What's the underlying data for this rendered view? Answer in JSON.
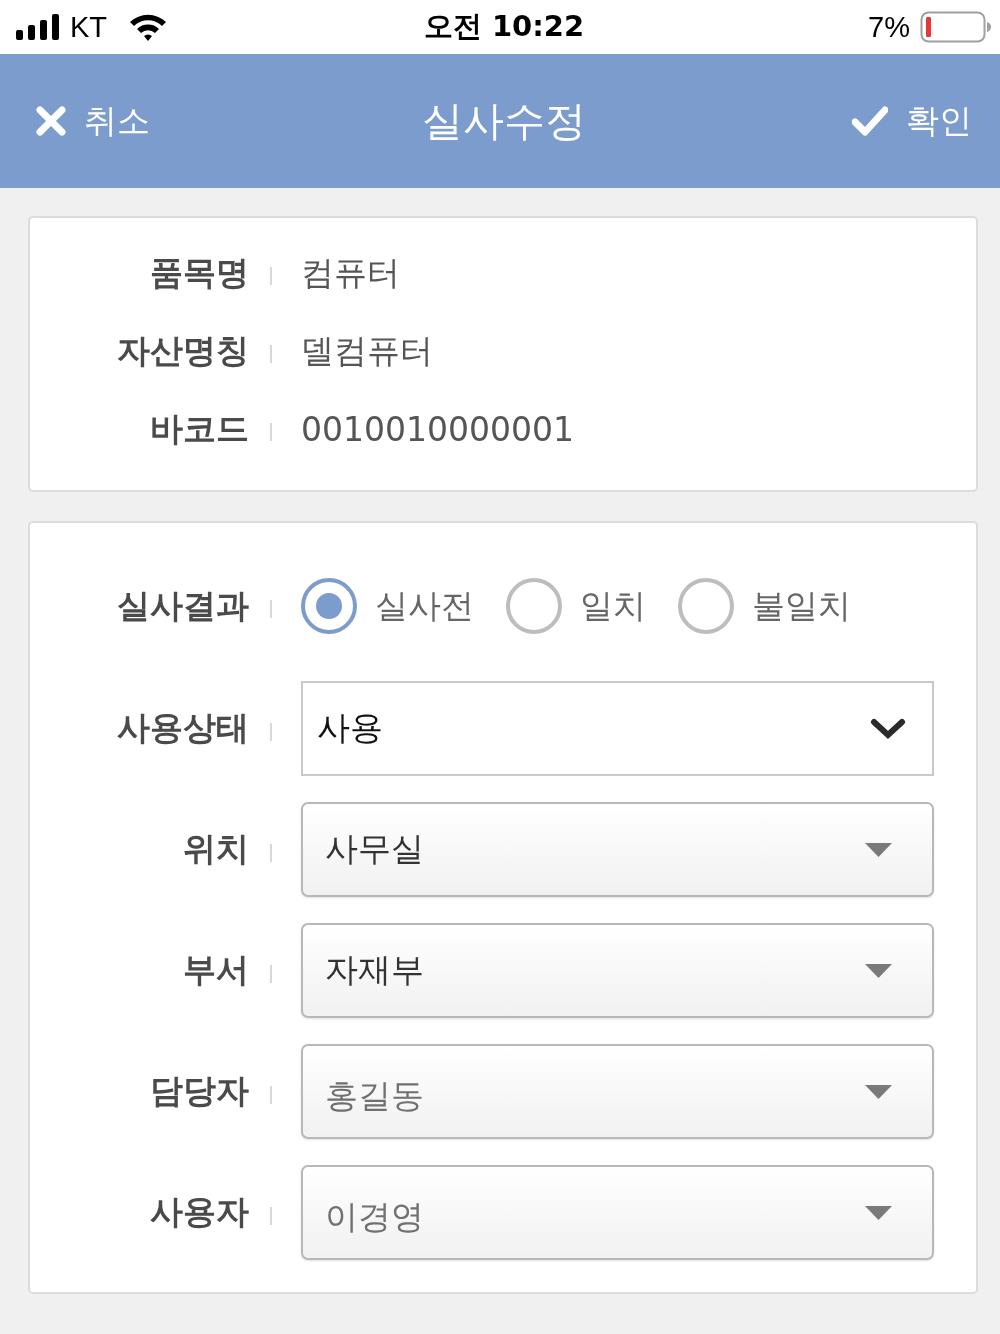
{
  "status_bar": {
    "carrier": "KT",
    "time": "오전 10:22",
    "battery": "7%"
  },
  "header": {
    "cancel": "취소",
    "title": "실사수정",
    "confirm": "확인"
  },
  "info": [
    {
      "label": "품목명",
      "value": "컴퓨터"
    },
    {
      "label": "자산명칭",
      "value": "델컴퓨터"
    },
    {
      "label": "바코드",
      "value": "0010010000001"
    }
  ],
  "result": {
    "label": "실사결과",
    "options": [
      {
        "label": "실사전",
        "selected": true
      },
      {
        "label": "일치",
        "selected": false
      },
      {
        "label": "불일치",
        "selected": false
      }
    ]
  },
  "fields": [
    {
      "label": "사용상태",
      "kind": "native",
      "value": "사용",
      "disabled": false
    },
    {
      "label": "위치",
      "kind": "menu",
      "value": "사무실",
      "disabled": false
    },
    {
      "label": "부서",
      "kind": "menu",
      "value": "자재부",
      "disabled": false
    },
    {
      "label": "담당자",
      "kind": "menu",
      "value": "홍길동",
      "disabled": true
    },
    {
      "label": "사용자",
      "kind": "menu",
      "value": "이경영",
      "disabled": true
    }
  ]
}
